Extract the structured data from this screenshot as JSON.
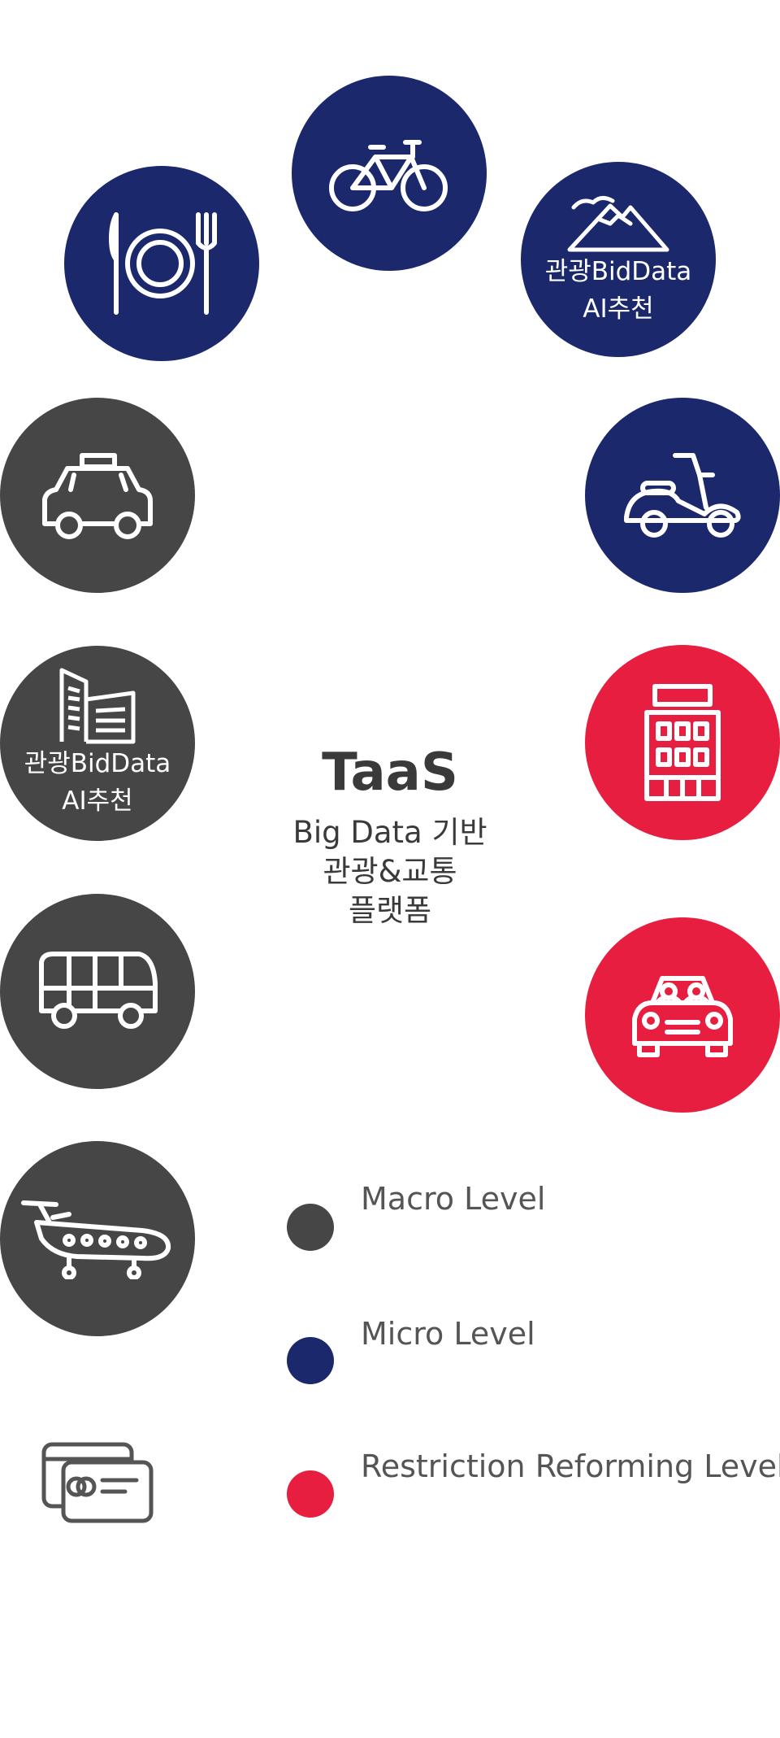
{
  "center": {
    "title": "TaaS",
    "subtitle_lines": [
      "Big Data 기반",
      "관광&교통",
      "플랫폼"
    ]
  },
  "circles": [
    {
      "icon": "bicycle-icon",
      "level": "micro",
      "label": ""
    },
    {
      "icon": "dining-icon",
      "level": "micro",
      "label": ""
    },
    {
      "icon": "mountain-icon",
      "level": "micro",
      "label": "관광BidData\nAI추천"
    },
    {
      "icon": "taxi-icon",
      "level": "macro",
      "label": ""
    },
    {
      "icon": "scooter-icon",
      "level": "micro",
      "label": ""
    },
    {
      "icon": "buildings-icon",
      "level": "macro",
      "label": "관광BidData\nAI추천"
    },
    {
      "icon": "hotel-icon",
      "level": "restriction",
      "label": ""
    },
    {
      "icon": "bus-icon",
      "level": "macro",
      "label": ""
    },
    {
      "icon": "shared-car-icon",
      "level": "restriction",
      "label": ""
    },
    {
      "icon": "airplane-icon",
      "level": "macro",
      "label": ""
    }
  ],
  "legend": [
    {
      "label": "Macro Level",
      "color": "#464646"
    },
    {
      "label": "Micro Level",
      "color": "#1b286b"
    },
    {
      "label": "Restriction Reforming Level",
      "color": "#e81e40"
    }
  ],
  "footer_icon": "credit-cards-icon",
  "colors": {
    "macro": "#464646",
    "micro": "#1b286b",
    "restriction": "#e81e40"
  }
}
